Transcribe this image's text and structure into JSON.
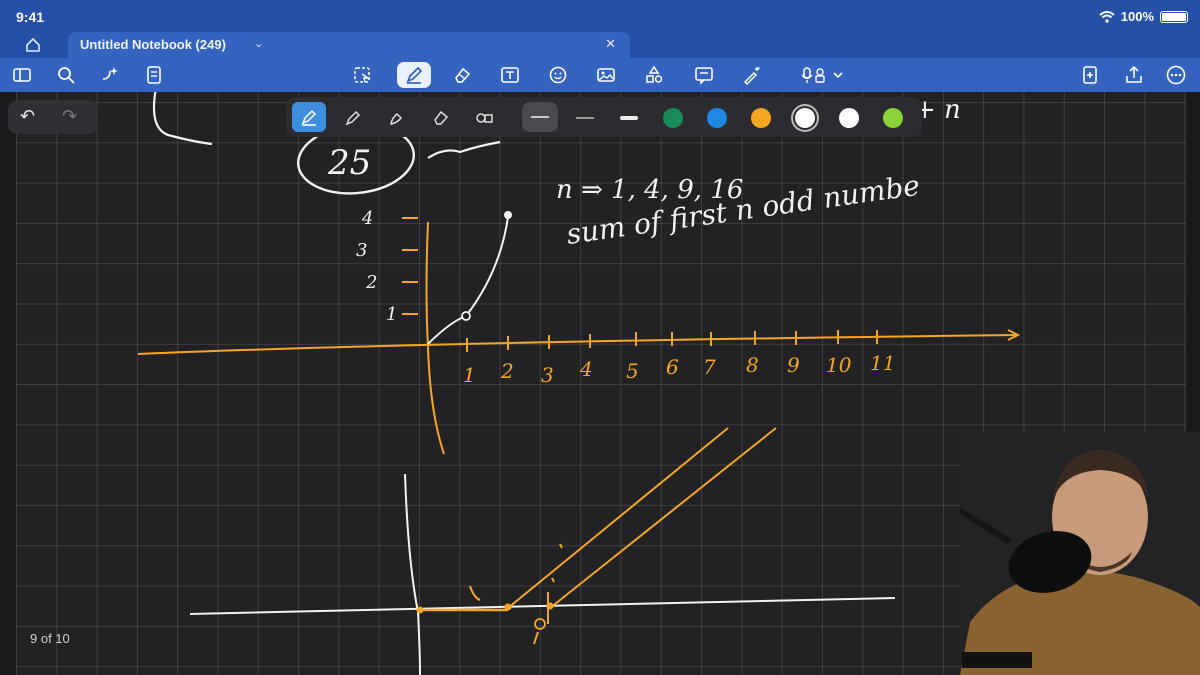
{
  "status": {
    "time": "9:41",
    "battery": "100%"
  },
  "tab": {
    "title": "Untitled Notebook (249)"
  },
  "toolbar": {
    "left": [
      "sidebar-icon",
      "search-icon",
      "sparkle-icon",
      "document-icon"
    ],
    "tools": [
      "lasso-icon",
      "pen-icon",
      "eraser-icon",
      "text-icon",
      "sticker-icon",
      "image-icon",
      "shapes-icon",
      "comment-icon",
      "laser-pointer-icon",
      "microphone-icon"
    ],
    "right": [
      "add-page-icon",
      "share-icon",
      "more-icon"
    ]
  },
  "pen_strip": {
    "tools": [
      "fountain-pen-icon",
      "ball-pen-icon",
      "brush-pen-icon",
      "eraser-icon",
      "shapes-icon"
    ],
    "colors": [
      "#1a8a5a",
      "#1e88e5",
      "#f5a623",
      "#ffffff",
      "#ffffff",
      "#8bd435"
    ]
  },
  "page": {
    "counter": "9 of 10"
  },
  "handwriting": {
    "top_circled": "25",
    "note_line1": "n ⇒ 1, 4, 9, 16",
    "note_line2": "sum of first n odd numbe",
    "top_right": "+ n",
    "y_ticks": [
      "4",
      "3",
      "2",
      "1"
    ],
    "x_ticks": [
      "1",
      "2",
      "3",
      "4",
      "5",
      "6",
      "7",
      "8",
      "9",
      "10",
      "11"
    ]
  }
}
